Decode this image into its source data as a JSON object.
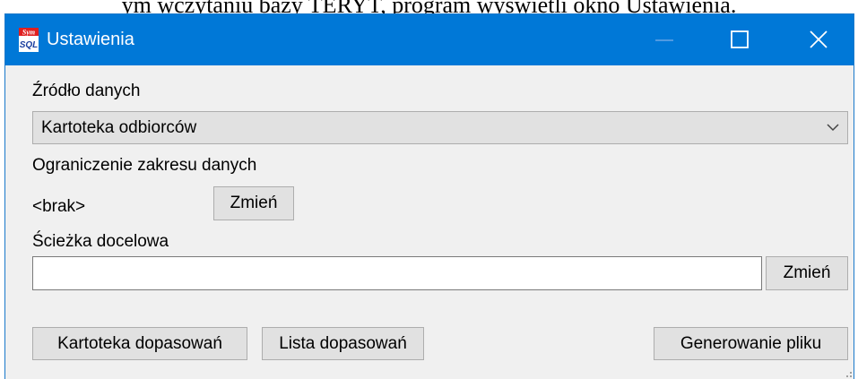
{
  "document": {
    "caption": "ym wczytaniu bazy TERYT, program wyświetli okno Ustawienia."
  },
  "window": {
    "title": "Ustawienia",
    "accent_color": "#0078d7",
    "icons": {
      "app": "symfonia-sql-icon",
      "minimize": "minimize-icon",
      "maximize": "maximize-icon",
      "close": "close-icon"
    }
  },
  "source": {
    "label": "Źródło danych",
    "selected": "Kartoteka odbiorców"
  },
  "range": {
    "label": "Ograniczenie zakresu danych",
    "value": "<brak>",
    "change_label": "Zmień"
  },
  "path": {
    "label": "Ścieżka docelowa",
    "value": "",
    "change_label": "Zmień"
  },
  "footer": {
    "matches_file_label": "Kartoteka dopasowań",
    "matches_list_label": "Lista dopasowań",
    "generate_label": "Generowanie pliku"
  }
}
